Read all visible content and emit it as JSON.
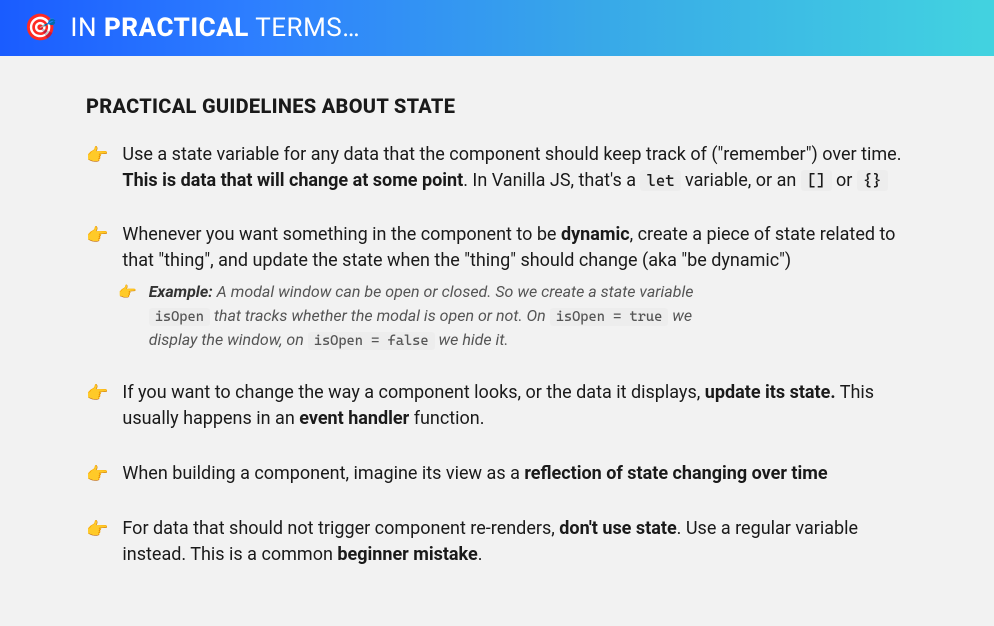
{
  "header": {
    "icon": "🎯",
    "title_prefix": "IN ",
    "title_bold": "PRACTICAL",
    "title_suffix": " TERMS…"
  },
  "section_title": "PRACTICAL GUIDELINES ABOUT STATE",
  "pointer_icon": "👉",
  "bullets": {
    "b1": {
      "t1": "Use a state variable for any data that the component should keep track of (\"remember\") over time. ",
      "b1": "This is data that will change at some point",
      "t2": ". In Vanilla JS, that's a ",
      "c1": "let",
      "t3": " variable, or an ",
      "c2": "[]",
      "t4": " or ",
      "c3": "{}"
    },
    "b2": {
      "t1": "Whenever you want something in the component to be ",
      "b1": "dynamic",
      "t2": ", create a piece of state related to that \"thing\", and update the state when the \"thing\" should change (aka \"be dynamic\")"
    },
    "example": {
      "label": "Example:",
      "t1": " A modal window can be open or closed. So we create a state variable ",
      "c1": "isOpen",
      "t2": " that tracks whether the modal is open or not. On ",
      "c2": "isOpen = true",
      "t3": " we display the window, on ",
      "c3": "isOpen = false",
      "t4": " we hide it."
    },
    "b3": {
      "t1": "If you want to change the way a component looks, or the data it displays, ",
      "b1": "update its state.",
      "t2": " This usually happens in an ",
      "b2": "event handler",
      "t3": " function."
    },
    "b4": {
      "t1": "When building a component, imagine its view as a ",
      "b1": "reflection of state changing over time"
    },
    "b5": {
      "t1": "For data that should not trigger component re-renders, ",
      "b1": "don't use state",
      "t2": ". Use a regular variable instead. This is a common ",
      "b2": "beginner mistake",
      "t3": "."
    }
  }
}
